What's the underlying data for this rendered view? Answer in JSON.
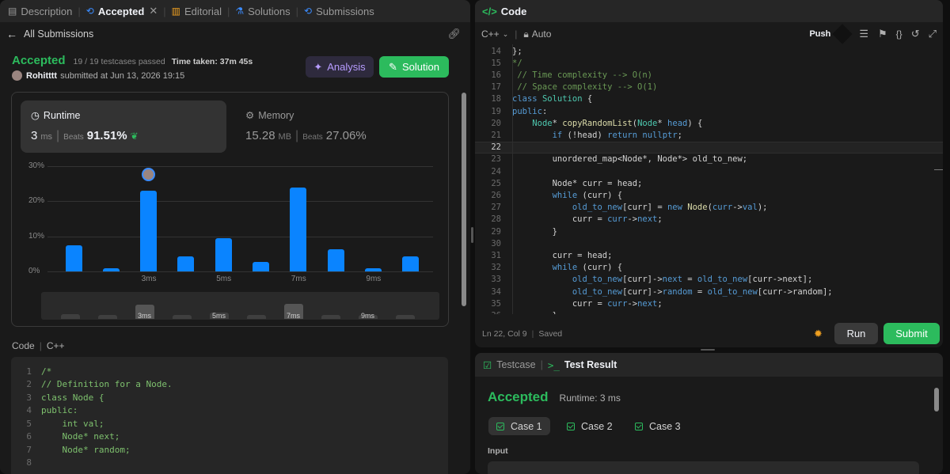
{
  "left": {
    "tabs": [
      {
        "label": "Description",
        "icon": "document-icon"
      },
      {
        "label": "Accepted",
        "icon": "history-icon"
      },
      {
        "label": "Editorial",
        "icon": "book-icon"
      },
      {
        "label": "Solutions",
        "icon": "flask-icon"
      },
      {
        "label": "Submissions",
        "icon": "history-icon"
      }
    ],
    "close_glyph": "✕",
    "back_label": "All Submissions",
    "status": "Accepted",
    "testcases": "19 / 19 testcases passed",
    "time_taken_label": "Time taken: 37m 45s",
    "user": "Rohitttt",
    "submitted_at": "submitted at Jun 13, 2026 19:15",
    "analysis_label": "Analysis",
    "solution_label": "Solution",
    "runtime": {
      "title": "Runtime",
      "value": "3",
      "unit": "ms",
      "beats_label": "Beats",
      "beats": "91.51%"
    },
    "memory": {
      "title": "Memory",
      "value": "15.28",
      "unit": "MB",
      "beats_label": "Beats",
      "beats": "27.06%"
    },
    "code_label": "Code",
    "lang_label": "C++",
    "code_lines": [
      {
        "n": "1",
        "t": "/*"
      },
      {
        "n": "2",
        "t": "// Definition for a Node."
      },
      {
        "n": "3",
        "t": "class Node {"
      },
      {
        "n": "4",
        "t": "public:"
      },
      {
        "n": "5",
        "t": "    int val;"
      },
      {
        "n": "6",
        "t": "    Node* next;"
      },
      {
        "n": "7",
        "t": "    Node* random;"
      },
      {
        "n": "8",
        "t": ""
      }
    ]
  },
  "chart_data": {
    "type": "bar",
    "title": "",
    "ylabel": "",
    "xlabel": "",
    "ylim": [
      0,
      30
    ],
    "y_ticks": [
      "30%",
      "20%",
      "10%",
      "0%"
    ],
    "x_tick_labels": [
      "3ms",
      "5ms",
      "7ms",
      "9ms"
    ],
    "values": [
      7.5,
      1,
      23,
      4.2,
      9.5,
      2.8,
      24,
      6.3,
      1,
      4.3
    ],
    "highlight_index": 2,
    "highlight_color": "#0a84ff",
    "minimap_labels": [
      "3ms",
      "5ms",
      "7ms",
      "9ms"
    ]
  },
  "code": {
    "title": "Code",
    "lang": "C++",
    "mode": "Auto",
    "push_label": "Push",
    "status": "Ln 22, Col 9",
    "saved": "Saved",
    "run_label": "Run",
    "submit_label": "Submit"
  },
  "result": {
    "tabs": [
      {
        "label": "Testcase"
      },
      {
        "label": "Test Result"
      }
    ],
    "status": "Accepted",
    "runtime": "Runtime: 3 ms",
    "cases": [
      "Case 1",
      "Case 2",
      "Case 3"
    ],
    "input_label": "Input"
  },
  "colors": {
    "accent_green": "#2cbb5d",
    "bar_blue": "#0a84ff",
    "analysis_purple": "#b79cff"
  }
}
